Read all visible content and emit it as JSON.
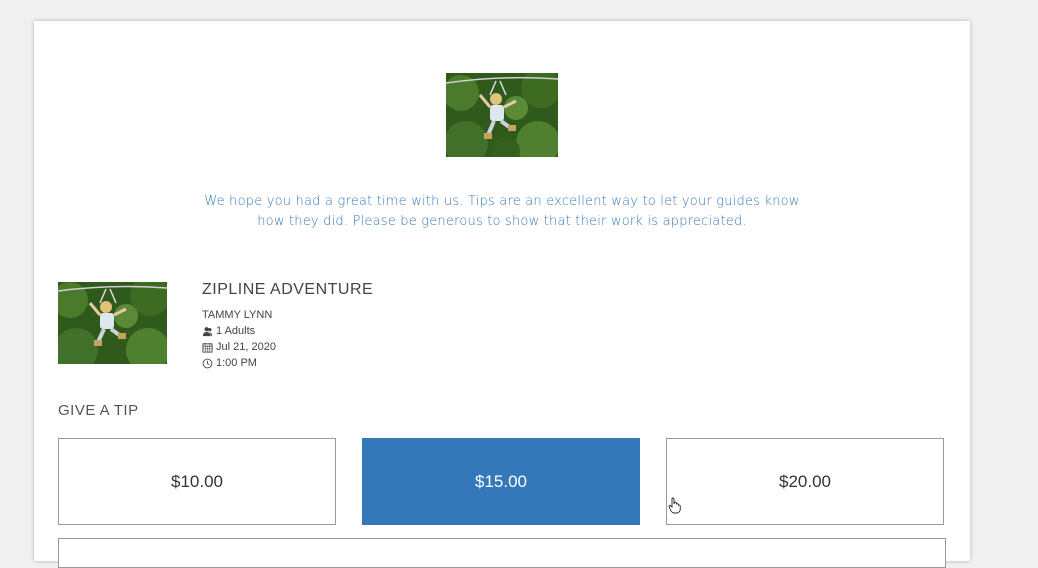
{
  "hero": {
    "image": "zipline-rider-photo"
  },
  "intro_text": "We hope you had a great time with us. Tips are an excellent way to let your guides know how they did. Please be generous to show that their work is appreciated.",
  "tour": {
    "image": "zipline-rider-photo",
    "title": "ZIPLINE ADVENTURE",
    "guest_name": "TAMMY LYNN",
    "guests": "1 Adults",
    "date": "Jul 21, 2020",
    "time": "1:00 PM"
  },
  "tip": {
    "heading": "GIVE A TIP",
    "options": [
      {
        "label": "$10.00",
        "selected": false
      },
      {
        "label": "$15.00",
        "selected": true
      },
      {
        "label": "$20.00",
        "selected": false
      }
    ],
    "selected_color": "#3478b9"
  },
  "theme": {
    "accent": "#3a7ab8"
  }
}
